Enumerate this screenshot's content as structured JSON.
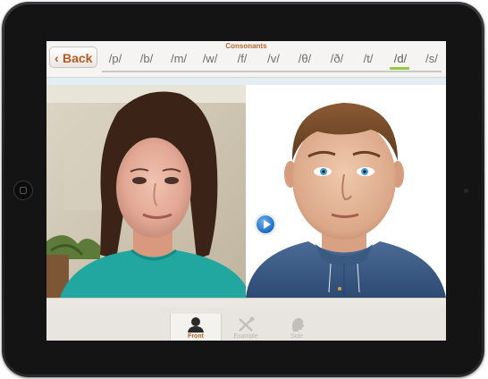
{
  "nav": {
    "section_title": "Consonants",
    "back_label": "Back",
    "phonemes": [
      "/p/",
      "/b/",
      "/m/",
      "/w/",
      "/f/",
      "/v/",
      "/θ/",
      "/ð/",
      "/t/",
      "/d/",
      "/s/"
    ],
    "selected_phoneme": "/d/"
  },
  "tabs": [
    {
      "label": "Front",
      "icon": "front-head-icon",
      "selected": true
    },
    {
      "label": "Example",
      "icon": "example-tools-icon",
      "selected": false
    },
    {
      "label": "Side",
      "icon": "side-head-icon",
      "selected": false
    }
  ],
  "icons": {
    "back": "chevron-left-icon",
    "play": "play-icon"
  },
  "colors": {
    "accent": "#b65b1e",
    "active_indicator": "#93c93d",
    "play_button": "#1c6cc4"
  }
}
